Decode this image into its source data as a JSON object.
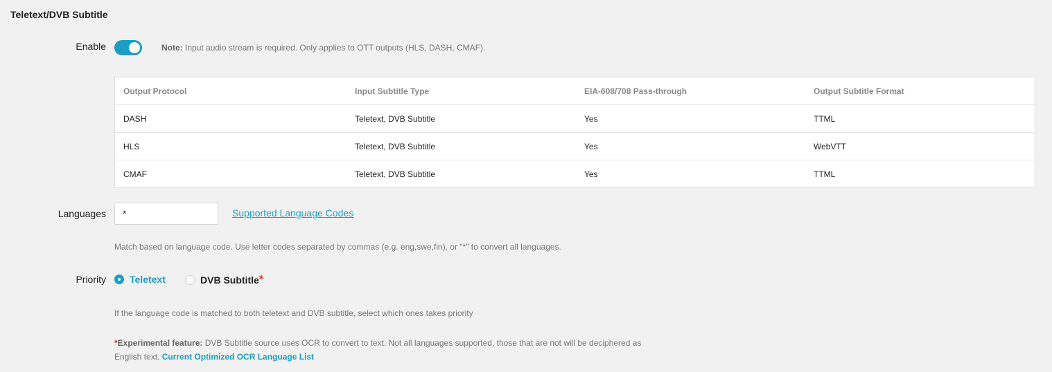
{
  "section": {
    "title": "Teletext/DVB Subtitle"
  },
  "enable": {
    "label": "Enable",
    "state": "on",
    "note_bold": "Note:",
    "note_text": " Input audio stream is required. Only applies to OTT outputs (HLS, DASH, CMAF)."
  },
  "table": {
    "headers": [
      "Output Protocol",
      "Input Subtitle Type",
      "EIA-608/708 Pass-through",
      "Output Subtitle Format"
    ],
    "rows": [
      [
        "DASH",
        "Teletext, DVB Subtitle",
        "Yes",
        "TTML"
      ],
      [
        "HLS",
        "Teletext, DVB Subtitle",
        "Yes",
        "WebVTT"
      ],
      [
        "CMAF",
        "Teletext, DVB Subtitle",
        "Yes",
        "TTML"
      ]
    ]
  },
  "languages": {
    "label": "Languages",
    "value": "*",
    "link": "Supported Language Codes",
    "help": "Match based on language code. Use letter codes separated by commas (e.g. eng,swe,fin), or \"*\" to convert all languages."
  },
  "priority": {
    "label": "Priority",
    "options": [
      "Teletext",
      "DVB Subtitle"
    ],
    "selected": "Teletext",
    "asterisk": "*",
    "help": "If the language code is matched to both teletext and DVB subtitle, select which ones takes priority"
  },
  "experimental": {
    "asterisk": "*",
    "bold": "Experimental feature:",
    "text": " DVB Subtitle source uses OCR to convert to text. Not all languages supported, those that are not will be deciphered as English text. ",
    "link": "Current Optimized OCR Language List"
  },
  "colors": {
    "accent": "#1b9ec4",
    "background": "#f0f1f0",
    "required": "#d9342b"
  }
}
